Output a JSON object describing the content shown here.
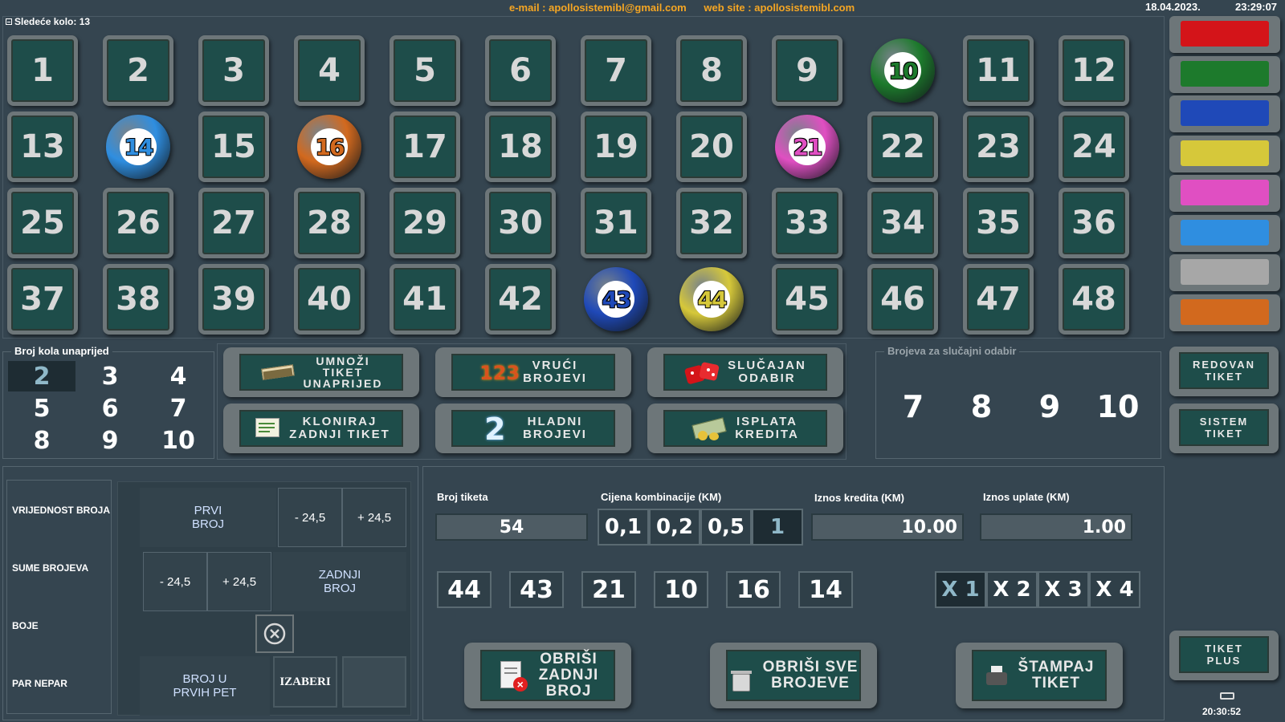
{
  "header": {
    "email": "e-mail : apollosistemibl@gmail.com",
    "website": "web site : apollosistemibl.com",
    "date": "18.04.2023.",
    "time": "23:29:07"
  },
  "next_round": "Sledeće kolo: 13",
  "numbers": [
    1,
    2,
    3,
    4,
    5,
    6,
    7,
    8,
    9,
    10,
    11,
    12,
    13,
    14,
    15,
    16,
    17,
    18,
    19,
    20,
    21,
    22,
    23,
    24,
    25,
    26,
    27,
    28,
    29,
    30,
    31,
    32,
    33,
    34,
    35,
    36,
    37,
    38,
    39,
    40,
    41,
    42,
    43,
    44,
    45,
    46,
    47,
    48
  ],
  "drawn_balls": [
    {
      "number": "10",
      "color": "green"
    },
    {
      "number": "14",
      "color": "light-blue"
    },
    {
      "number": "16",
      "color": "orange"
    },
    {
      "number": "21",
      "color": "pink"
    },
    {
      "number": "43",
      "color": "blue"
    },
    {
      "number": "44",
      "color": "yellow"
    }
  ],
  "colors": {
    "red": "#d41419",
    "green": "#1d7a2c",
    "blue": "#1f49b8",
    "yellow": "#d6c83a",
    "pink": "#e04fc2",
    "light-blue": "#2f8ee0",
    "gray": "#a7a7a7",
    "orange": "#d2691e"
  },
  "swatches": [
    "red",
    "green",
    "blue",
    "yellow",
    "pink",
    "light-blue",
    "gray",
    "orange"
  ],
  "rounds_ahead": {
    "legend": "Broj kola unaprijed",
    "values": [
      "2",
      "3",
      "4",
      "5",
      "6",
      "7",
      "8",
      "9",
      "10"
    ],
    "selected": "2"
  },
  "menu_buttons": {
    "multiply": "UMNOŽI\nTIKET\nUNAPRIJED",
    "hot": "VRUĆI\nBROJEVI",
    "random": "SLUČAJAN\nODABIR",
    "clone": "KLONIRAJ\nZADNJI TIKET",
    "cold": "HLADNI\nBROJEVI",
    "payout": "ISPLATA\nKREDITA",
    "hot_icon_text": "123",
    "cold_icon_text": "2"
  },
  "random_pick": {
    "legend": "Brojeva za slučajni odabir",
    "values": [
      "7",
      "8",
      "9",
      "10"
    ]
  },
  "side_buttons": {
    "regular": "REDOVAN\nTIKET",
    "system": "SISTEM\nTIKET",
    "plus": "TIKET\nPLUS"
  },
  "stats": {
    "labels": [
      "VRIJEDNOST BROJA",
      "SUME BROJEVA",
      "BOJE",
      "PAR NEPAR"
    ],
    "first_number": "PRVI\nBROJ",
    "last_number": "ZADNJI\nBROJ",
    "minus": "- 24,5",
    "plus": "+ 24,5",
    "first_five": "BROJ U\nPRVIH PET",
    "choose": "IZABERI"
  },
  "ticket": {
    "ticket_no_label": "Broj tiketa",
    "ticket_no": "54",
    "price_label": "Cijena kombinacije (KM)",
    "prices": [
      "0,1",
      "0,2",
      "0,5",
      "1"
    ],
    "selected_price": "1",
    "credit_label": "Iznos kredita (KM)",
    "credit": "10.00",
    "stake_label": "Iznos uplate (KM)",
    "stake": "1.00",
    "picked": [
      "44",
      "43",
      "21",
      "10",
      "16",
      "14"
    ],
    "multipliers": [
      "X 1",
      "X 2",
      "X 3",
      "X 4"
    ],
    "selected_multiplier": "X 1"
  },
  "actions": {
    "delete_last": "OBRIŠI\nZADNJI\nBROJ",
    "delete_all": "OBRIŠI SVE\nBROJEVE",
    "print": "ŠTAMPAJ\nTIKET"
  },
  "clock": "20:30:52"
}
